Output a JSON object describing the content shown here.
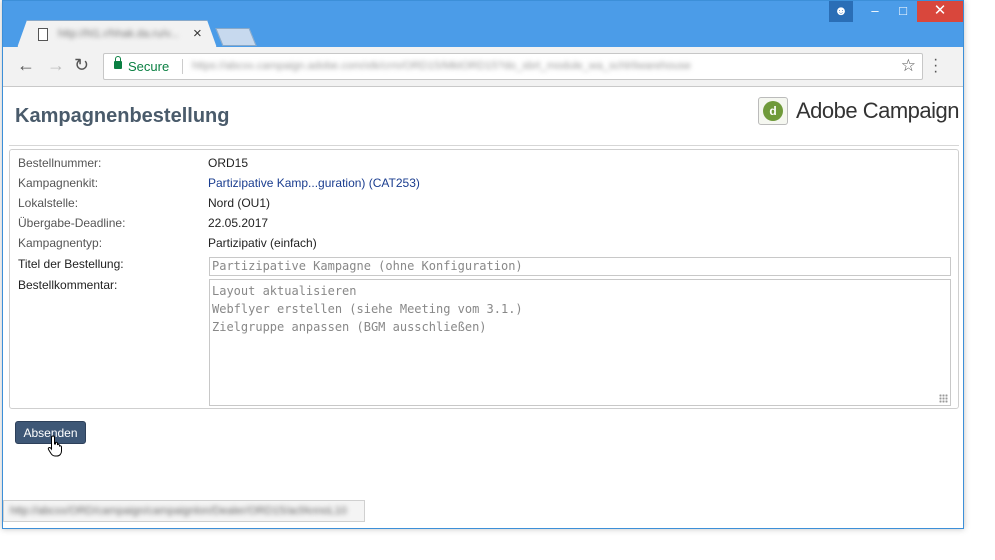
{
  "browser": {
    "tab_title": "http://hl1.r/hhak.da.ru/v...",
    "tab_close": "×",
    "secure_label": "Secure",
    "url": "https://abcxx.campaign.adobe.com/xtk/crm/ORD15/MktORD15?do_sbrt_module_wa_schlrliwarehouse",
    "status_url": "http://abcxx/ORD/campaign/campaignlon/Dealer/ORD15/acfAnnoL10",
    "colors": {
      "titlebar": "#4b9ce8",
      "close": "#d9473c"
    }
  },
  "page": {
    "title": "Kampagnenbestellung",
    "logo_text": "Adobe Campaign"
  },
  "fields": [
    {
      "label": "Bestellnummer:",
      "value": "ORD15"
    },
    {
      "label": "Kampagnenkit:",
      "value": "Partizipative Kamp...guration) (CAT253)"
    },
    {
      "label": "Lokalstelle:",
      "value": "Nord (OU1)"
    },
    {
      "label": "Übergabe-Deadline:",
      "value": "22.05.2017"
    },
    {
      "label": "Kampagnentyp:",
      "value": "Partizipativ (einfach)"
    }
  ],
  "order_title": {
    "label": "Titel der Bestellung:",
    "value": "Partizipative Kampagne (ohne Konfiguration)"
  },
  "order_comment": {
    "label": "Bestellkommentar:",
    "lines": [
      "Layout aktualisieren",
      "Webflyer erstellen (siehe Meeting vom 3.1.)",
      "Zielgruppe anpassen (BGM ausschließen)"
    ]
  },
  "submit_label": "Absenden"
}
